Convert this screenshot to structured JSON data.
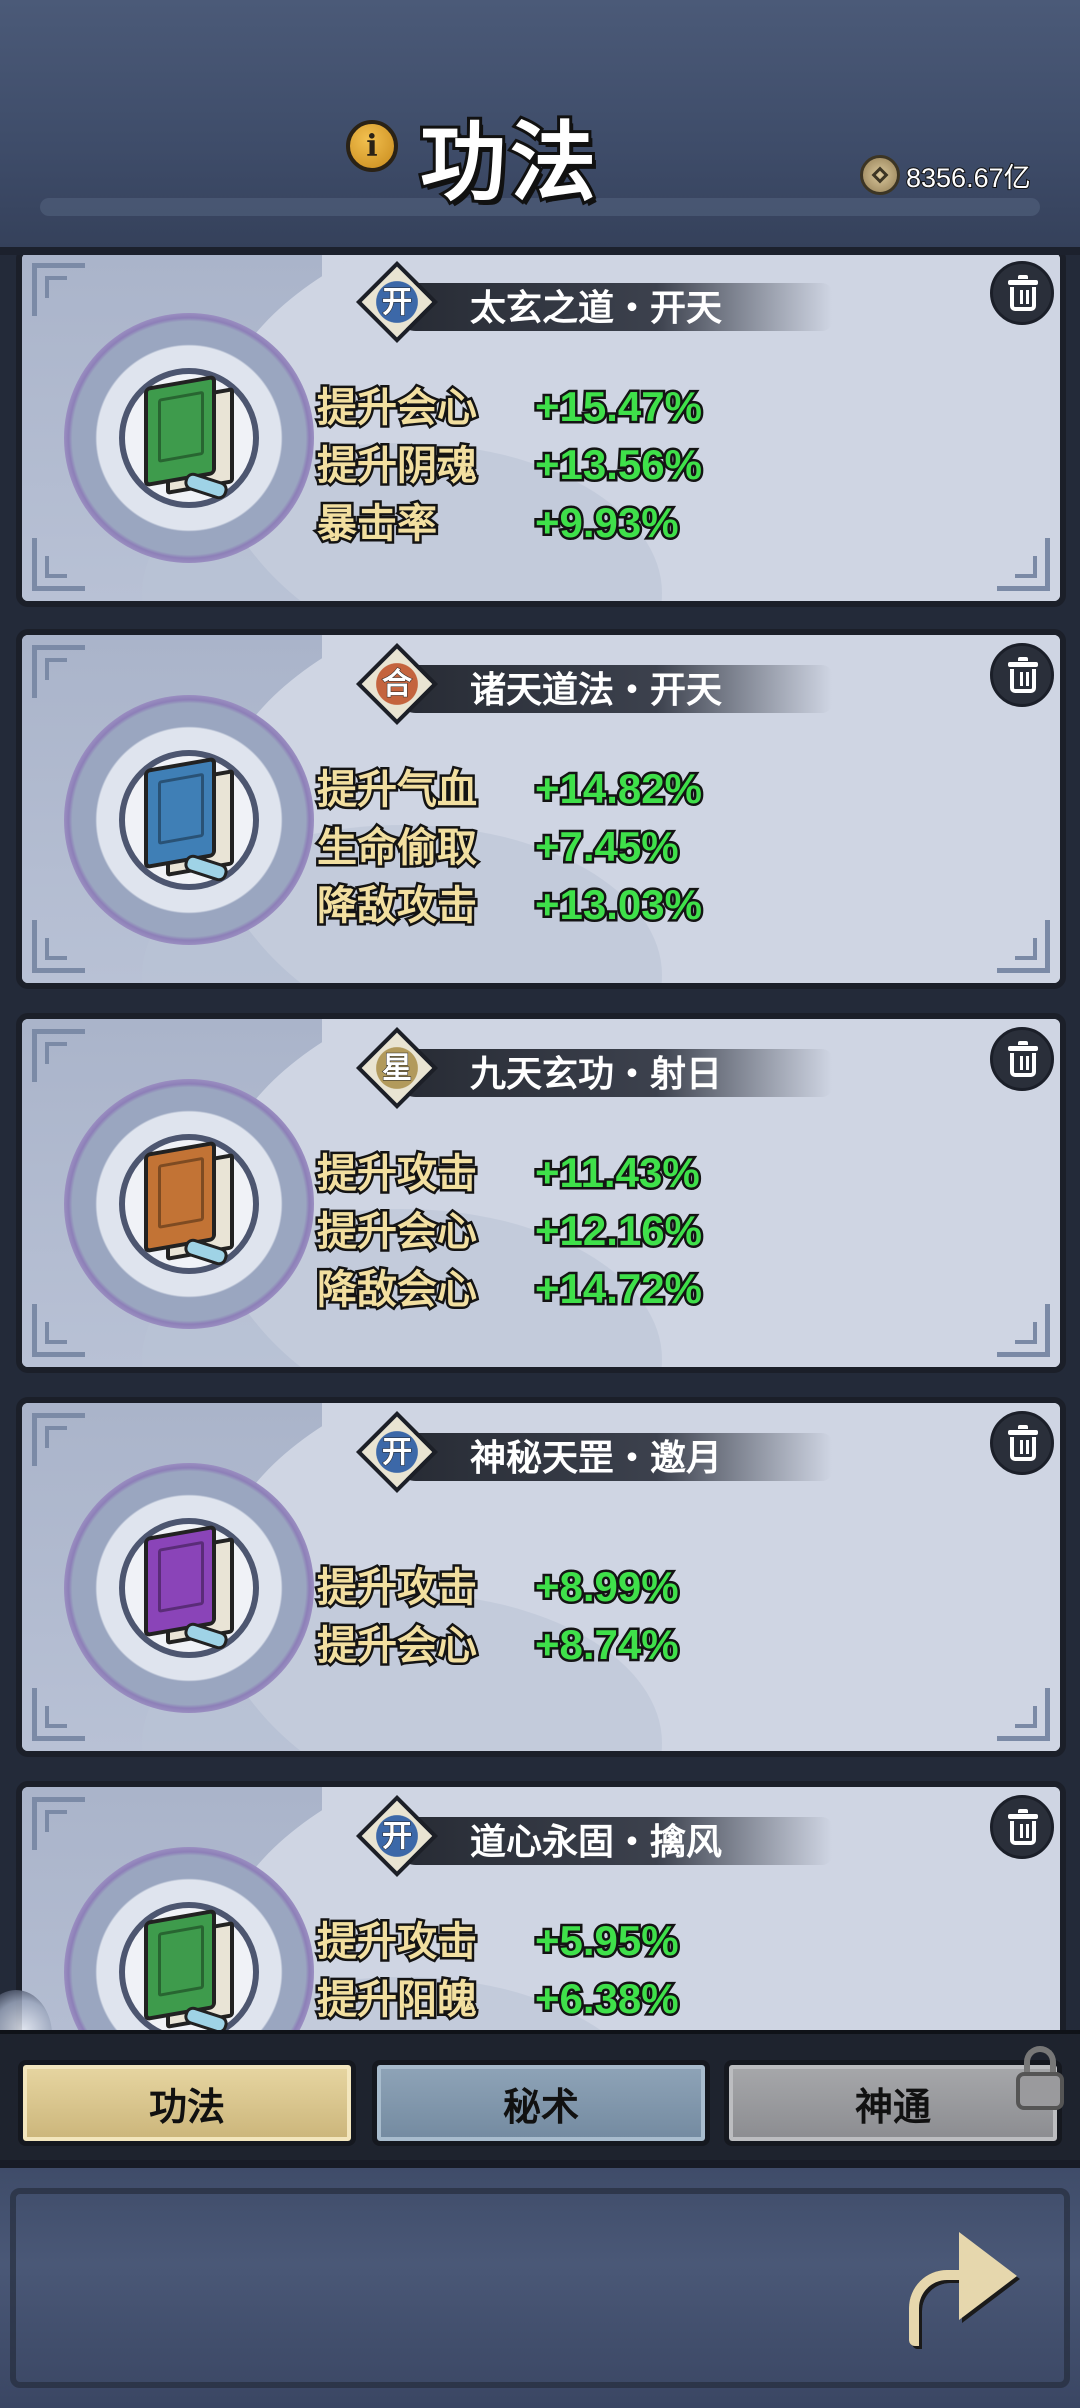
{
  "header": {
    "info_icon": "i",
    "title": "功法",
    "currency_icon": "coin-icon",
    "currency_amount": "8356.67亿"
  },
  "colors": {
    "stat_label": "#f2dfa0",
    "stat_value": "#3fe04a",
    "tag_kai": "#3c68a8",
    "tag_he": "#c4643e",
    "tag_xing": "#b29a5c",
    "book_green": "#3e9b4c",
    "book_blue": "#3f7fb6",
    "book_orange": "#c27335",
    "book_purple": "#8a44b8"
  },
  "skills": [
    {
      "tag": "开",
      "tag_color": "#3c68a8",
      "name": "太玄之道・开天",
      "book_color": "#3e9b4c",
      "stats": [
        {
          "label": "提升会心",
          "value": "+15.47%"
        },
        {
          "label": "提升阴魂",
          "value": "+13.56%"
        },
        {
          "label": "暴击率",
          "value": "+9.93%"
        }
      ]
    },
    {
      "tag": "合",
      "tag_color": "#c4643e",
      "name": "诸天道法・开天",
      "book_color": "#3f7fb6",
      "stats": [
        {
          "label": "提升气血",
          "value": "+14.82%"
        },
        {
          "label": "生命偷取",
          "value": "+7.45%"
        },
        {
          "label": "降敌攻击",
          "value": "+13.03%"
        }
      ]
    },
    {
      "tag": "星",
      "tag_color": "#b29a5c",
      "name": "九天玄功・射日",
      "book_color": "#c27335",
      "stats": [
        {
          "label": "提升攻击",
          "value": "+11.43%"
        },
        {
          "label": "提升会心",
          "value": "+12.16%"
        },
        {
          "label": "降敌会心",
          "value": "+14.72%"
        }
      ]
    },
    {
      "tag": "开",
      "tag_color": "#3c68a8",
      "name": "神秘天罡・邀月",
      "book_color": "#8a44b8",
      "stats": [
        {
          "label": "提升攻击",
          "value": "+8.99%"
        },
        {
          "label": "提升会心",
          "value": "+8.74%"
        }
      ]
    },
    {
      "tag": "开",
      "tag_color": "#3c68a8",
      "name": "道心永固・擒风",
      "book_color": "#3e9b4c",
      "stats": [
        {
          "label": "提升攻击",
          "value": "+5.95%"
        },
        {
          "label": "提升阳魄",
          "value": "+6.38%"
        }
      ]
    }
  ],
  "tabs": [
    {
      "label": "功法",
      "state": "selected"
    },
    {
      "label": "秘术",
      "state": "normal"
    },
    {
      "label": "神通",
      "state": "locked"
    }
  ],
  "icons": {
    "delete": "trash-icon",
    "lock": "lock-icon",
    "back": "back-arrow-icon",
    "skill_book": "book-icon"
  }
}
